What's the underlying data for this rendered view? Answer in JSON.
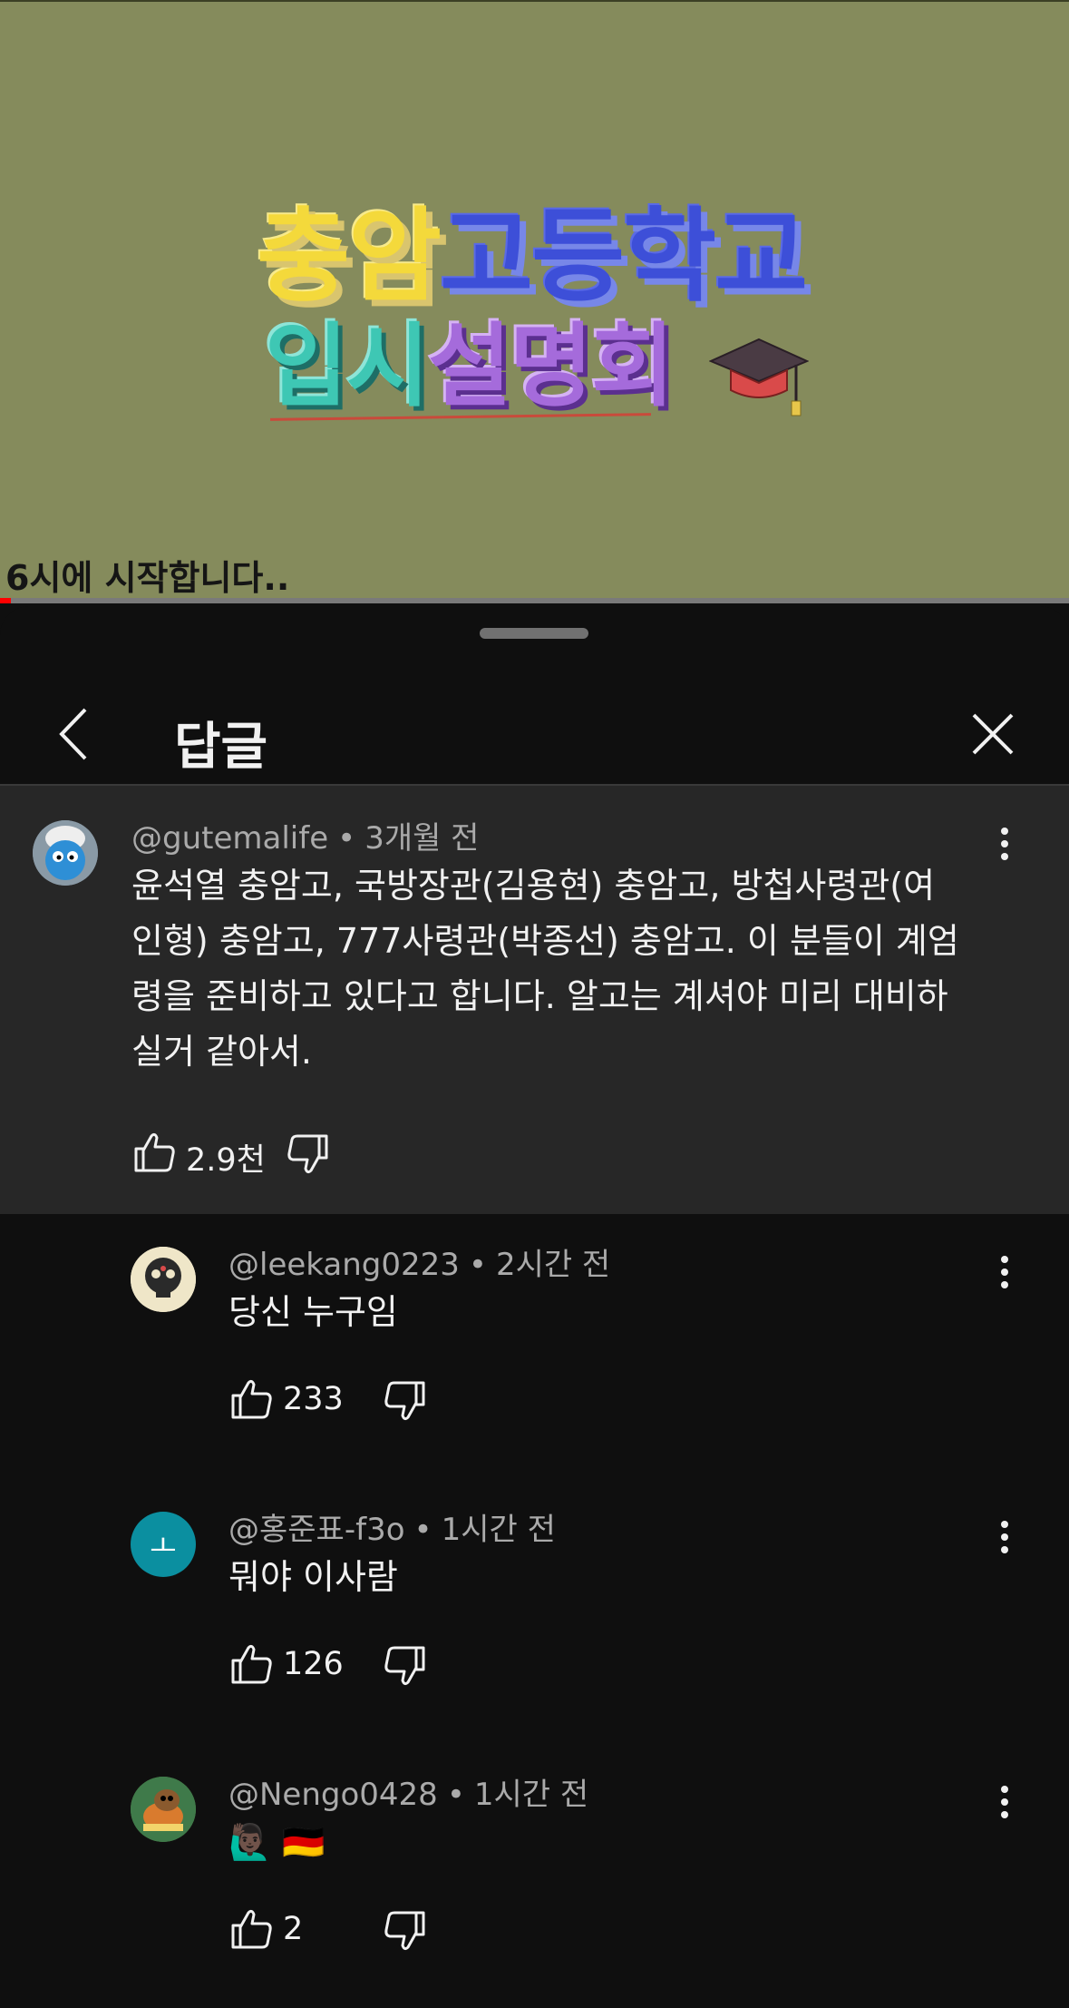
{
  "video": {
    "title_part1": "충암",
    "title_part2": "고등학교",
    "title_part3": "입시",
    "title_part4": "설명회",
    "caption": "6시에 시작합니다..",
    "progress": 0.01
  },
  "panel": {
    "title": "답글"
  },
  "parent_comment": {
    "author": "@gutemalife",
    "time": "3개월 전",
    "lines": [
      "윤석열 충암고, 국방장관(김용현) 충암고, 방첩사령관(여",
      "인형) 충암고, 777사령관(박종선) 충암고. 이 분들이 계엄",
      "령을 준비하고 있다고 합니다. 알고는 계셔야 미리 대비하",
      "실거 같아서."
    ],
    "likes": "2.9천"
  },
  "replies": [
    {
      "author": "@leekang0223",
      "time": "2시간 전",
      "text": "당신 누구임",
      "likes": "233"
    },
    {
      "author": "@홍준표-f3o",
      "time": "1시간 전",
      "text": "뭐야 이사람",
      "likes": "126",
      "avatar_letter": "ㅗ"
    },
    {
      "author": "@Nengo0428",
      "time": "1시간 전",
      "text": "🙋🏿‍♂️ 🇩🇪",
      "likes": "2"
    }
  ],
  "colors": {
    "video_bg": "#858b5c",
    "panel_bg": "#0f0f0f",
    "parent_bg": "#272727",
    "meta_text": "#aaaaaa",
    "teal_avatar": "#0b8fa0"
  }
}
